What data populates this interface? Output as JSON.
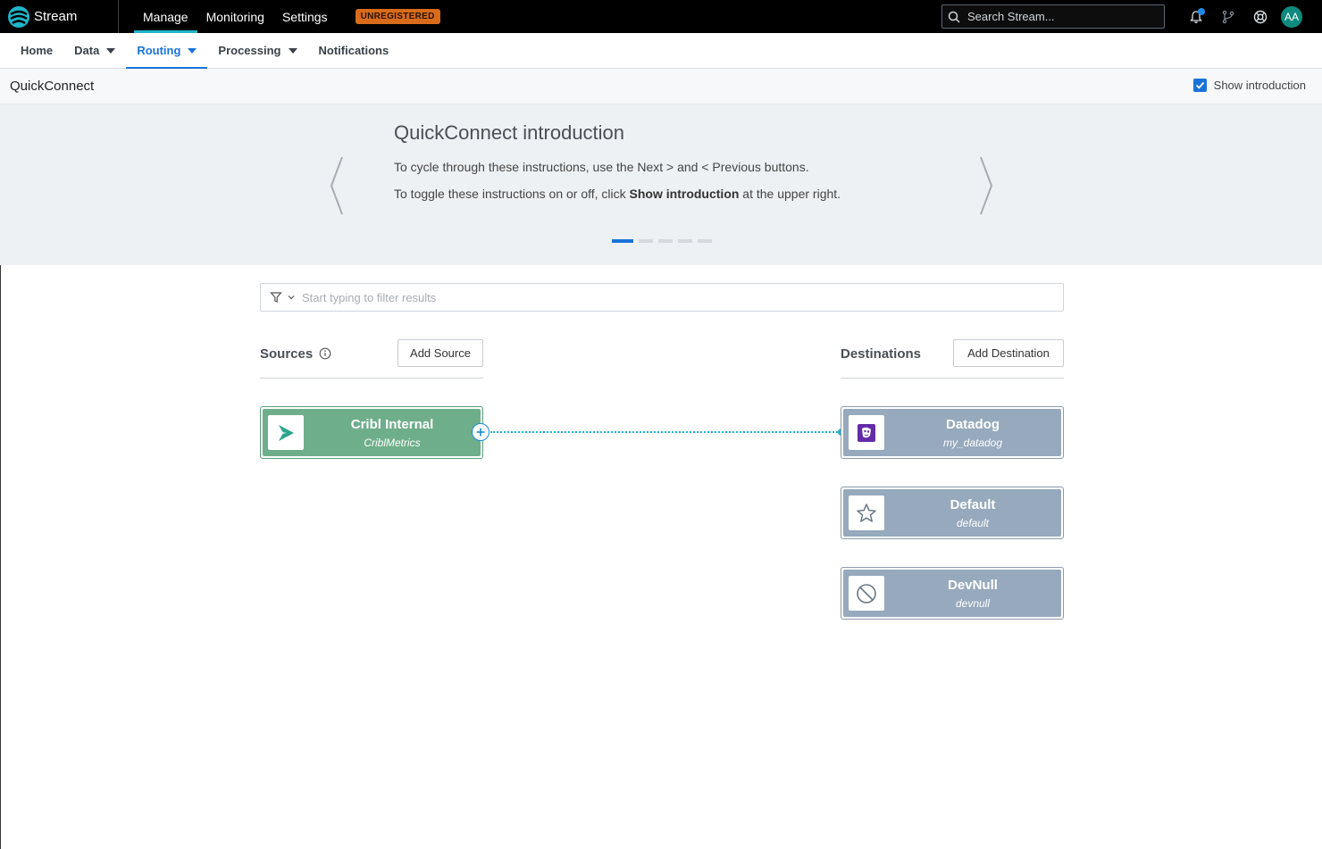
{
  "topbar": {
    "brand": "Stream",
    "nav": [
      {
        "label": "Manage",
        "active": true
      },
      {
        "label": "Monitoring",
        "active": false
      },
      {
        "label": "Settings",
        "active": false
      }
    ],
    "badge": "UNREGISTERED",
    "search_placeholder": "Search Stream...",
    "avatar_initials": "AA",
    "icons": [
      "bell-icon",
      "git-branch-icon",
      "lifebuoy-icon"
    ]
  },
  "subnav": {
    "items": [
      {
        "label": "Home",
        "dropdown": false,
        "active": false
      },
      {
        "label": "Data",
        "dropdown": true,
        "active": false
      },
      {
        "label": "Routing",
        "dropdown": true,
        "active": true
      },
      {
        "label": "Processing",
        "dropdown": true,
        "active": false
      },
      {
        "label": "Notifications",
        "dropdown": false,
        "active": false
      }
    ]
  },
  "page": {
    "title": "QuickConnect",
    "show_intro_label": "Show introduction",
    "show_intro_checked": true
  },
  "intro": {
    "title": "QuickConnect introduction",
    "line1": "To cycle through these instructions, use the Next > and < Previous buttons.",
    "line2_pre": "To toggle these instructions on or off, click ",
    "line2_bold": "Show introduction",
    "line2_post": " at the upper right.",
    "slides": 5,
    "active_slide": 1
  },
  "filter": {
    "placeholder": "Start typing to filter results"
  },
  "sources": {
    "title": "Sources",
    "add_label": "Add Source",
    "items": [
      {
        "name": "Cribl Internal",
        "id": "CriblMetrics",
        "icon": "cribl-internal-icon"
      }
    ]
  },
  "destinations": {
    "title": "Destinations",
    "add_label": "Add Destination",
    "items": [
      {
        "name": "Datadog",
        "id": "my_datadog",
        "icon": "datadog-icon"
      },
      {
        "name": "Default",
        "id": "default",
        "icon": "star-icon"
      },
      {
        "name": "DevNull",
        "id": "devnull",
        "icon": "prohibited-icon"
      }
    ]
  },
  "colors": {
    "accent": "#1a73d9",
    "teal": "#1fb5c9",
    "source_card": "#6fae8b",
    "dest_card": "#96a9bd",
    "badge": "#d96c1a"
  }
}
